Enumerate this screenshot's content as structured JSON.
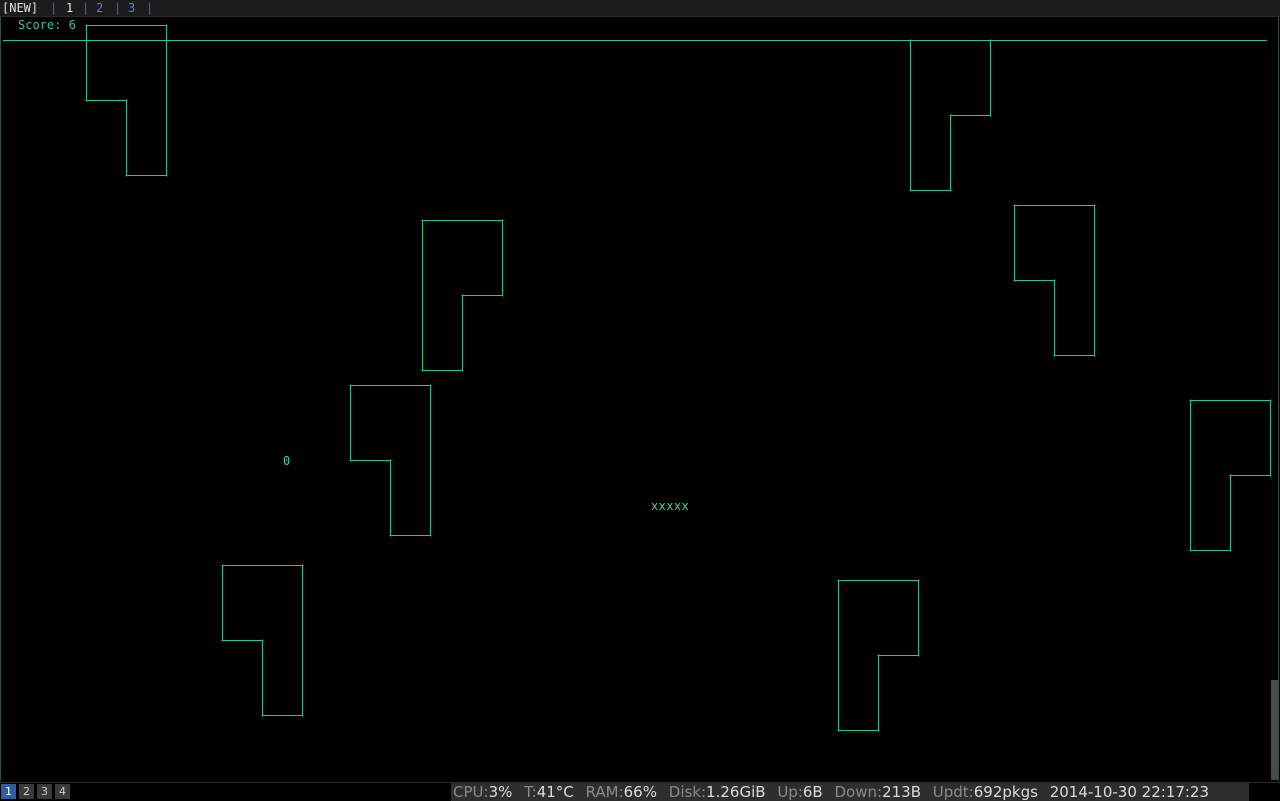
{
  "tabs": {
    "new_label": "[NEW]",
    "items": [
      {
        "label": "1",
        "active": true
      },
      {
        "label": "2",
        "active": false
      },
      {
        "label": "3",
        "active": false
      }
    ],
    "separator": "|"
  },
  "game": {
    "score_text": "Score: 6",
    "snake_text": "xxxxx",
    "food_text": "0",
    "color": "#2fbf9a"
  },
  "workspaces": [
    "1",
    "2",
    "3",
    "4"
  ],
  "status": {
    "cpu_label": "CPU:",
    "cpu_value": "3%",
    "temp_label": "T:",
    "temp_value": "41°C",
    "ram_label": "RAM:",
    "ram_value": "66%",
    "disk_label": "Disk:",
    "disk_value": "1.26GiB",
    "up_label": "Up:",
    "up_value": "6B",
    "down_label": "Down:",
    "down_value": "213B",
    "updt_label": "Updt:",
    "updt_value": "692pkgs",
    "datetime": "2014-10-30 22:17:23"
  }
}
